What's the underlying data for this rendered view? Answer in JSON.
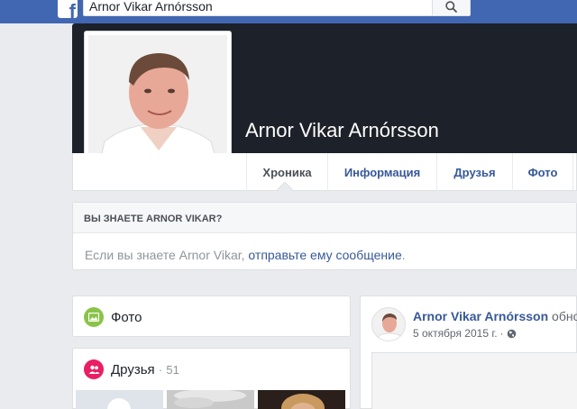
{
  "topbar": {
    "search_value": "Arnor Vikar Arnórsson",
    "brand_color": "#4267b2"
  },
  "profile": {
    "name": "Arnor Vikar Arnórsson"
  },
  "tabs": [
    {
      "label": "Хроника",
      "active": true
    },
    {
      "label": "Информация",
      "active": false
    },
    {
      "label": "Друзья",
      "active": false
    },
    {
      "label": "Фото",
      "active": false
    }
  ],
  "know_box": {
    "title": "ВЫ ЗНАЕТЕ ARNOR VIKAR?",
    "text_before": "Если вы знаете Arnor Vikar, ",
    "link": "отправьте ему сообщение",
    "text_after": "."
  },
  "left_cards": {
    "photo_title": "Фото",
    "friends_title": "Друзья",
    "friends_sep": "·",
    "friends_count": "51"
  },
  "post": {
    "author": "Arnor Vikar Arnórsson",
    "action": "обнов",
    "date": "5 октября 2015 г."
  },
  "icons": {
    "photo": "photo-icon",
    "friends": "friends-icon",
    "search": "search-icon",
    "privacy": "globe-icon"
  }
}
